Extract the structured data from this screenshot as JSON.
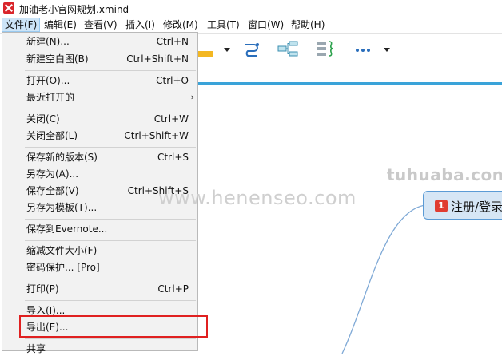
{
  "window": {
    "title": "加油老小官网规划.xmind"
  },
  "menubar": {
    "items": [
      {
        "label": "文件(F)",
        "active": true
      },
      {
        "label": "编辑(E)"
      },
      {
        "label": "查看(V)"
      },
      {
        "label": "插入(I)"
      },
      {
        "label": "修改(M)"
      },
      {
        "label": "工具(T)"
      },
      {
        "label": "窗口(W)"
      },
      {
        "label": "帮助(H)"
      }
    ]
  },
  "file_menu": {
    "items": [
      {
        "label": "新建(N)...",
        "shortcut": "Ctrl+N"
      },
      {
        "label": "新建空白图(B)",
        "shortcut": "Ctrl+Shift+N"
      },
      {
        "label": "打开(O)...",
        "shortcut": "Ctrl+O"
      },
      {
        "label": "最近打开的",
        "submenu": "›"
      },
      {
        "label": "关闭(C)",
        "shortcut": "Ctrl+W"
      },
      {
        "label": "关闭全部(L)",
        "shortcut": "Ctrl+Shift+W"
      },
      {
        "label": "保存新的版本(S)",
        "shortcut": "Ctrl+S"
      },
      {
        "label": "另存为(A)..."
      },
      {
        "label": "保存全部(V)",
        "shortcut": "Ctrl+Shift+S"
      },
      {
        "label": "另存为模板(T)..."
      },
      {
        "label": "保存到Evernote..."
      },
      {
        "label": "缩减文件大小(F)"
      },
      {
        "label": "密码保护... [Pro]"
      },
      {
        "label": "打印(P)",
        "shortcut": "Ctrl+P"
      },
      {
        "label": "导入(I)..."
      },
      {
        "label": "导出(E)..."
      },
      {
        "label": "共享"
      }
    ]
  },
  "canvas": {
    "topic": {
      "badge": "1",
      "label": "注册/登录"
    }
  },
  "watermarks": {
    "primary": "tuhuaba.com",
    "secondary": "www.henenseo.com"
  },
  "colors": {
    "accent": "#3aa3d9",
    "topic_fill": "#d6e6f5",
    "topic_border": "#5b9bd5",
    "highlight": "#e02020",
    "badge": "#e03c31"
  }
}
